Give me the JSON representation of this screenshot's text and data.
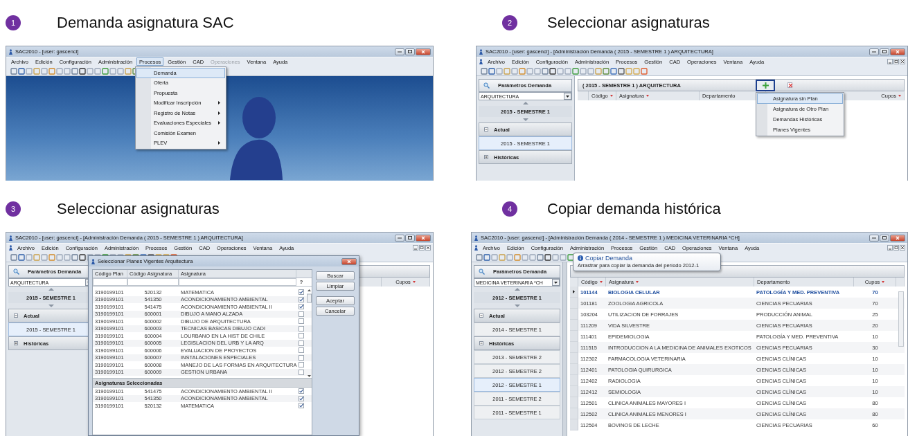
{
  "steps": [
    {
      "number": "1",
      "title": "Demanda asignatura SAC",
      "kind": "menu",
      "window": {
        "title": "SAC2010 - [user: gascenci]",
        "menus": [
          {
            "label": "Archivo",
            "selected": false,
            "disabled": false
          },
          {
            "label": "Edición",
            "selected": false,
            "disabled": false
          },
          {
            "label": "Configuración",
            "selected": false,
            "disabled": false
          },
          {
            "label": "Administración",
            "selected": false,
            "disabled": false
          },
          {
            "label": "Procesos",
            "selected": true,
            "disabled": false
          },
          {
            "label": "Gestión",
            "selected": false,
            "disabled": false
          },
          {
            "label": "CAD",
            "selected": false,
            "disabled": false
          },
          {
            "label": "Operaciones",
            "selected": false,
            "disabled": true
          },
          {
            "label": "Ventana",
            "selected": false,
            "disabled": false
          },
          {
            "label": "Ayuda",
            "selected": false,
            "disabled": false
          }
        ],
        "dropdown": [
          {
            "label": "Demanda",
            "selected": true,
            "submenu": false
          },
          {
            "label": "Oferta",
            "selected": false,
            "submenu": false
          },
          {
            "label": "Propuesta",
            "selected": false,
            "submenu": false
          },
          {
            "label": "Modificar Inscripción",
            "selected": false,
            "submenu": true
          },
          {
            "label": "Registro de Notas",
            "selected": false,
            "submenu": true
          },
          {
            "label": "Evaluaciones Especiales",
            "selected": false,
            "submenu": true
          },
          {
            "label": "Comisión Examen",
            "selected": false,
            "submenu": false
          },
          {
            "label": "PLEV",
            "selected": false,
            "submenu": true
          }
        ]
      }
    },
    {
      "number": "2",
      "title": "Seleccionar asignaturas",
      "kind": "add_menu",
      "window": {
        "title": "SAC2010 - [user: gascenci] - [Administración Demanda ( 2015 - SEMESTRE 1 ) ARQUITECTURA]",
        "menus": [
          {
            "label": "Archivo",
            "selected": false
          },
          {
            "label": "Edición",
            "selected": false
          },
          {
            "label": "Configuración",
            "selected": false
          },
          {
            "label": "Administración",
            "selected": false
          },
          {
            "label": "Procesos",
            "selected": false
          },
          {
            "label": "Gestión",
            "selected": false
          },
          {
            "label": "CAD",
            "selected": false
          },
          {
            "label": "Operaciones",
            "selected": false
          },
          {
            "label": "Ventana",
            "selected": false
          },
          {
            "label": "Ayuda",
            "selected": false
          }
        ],
        "sidebar": {
          "header": "Parámetros Demanda",
          "career": "ARQUITECTURA",
          "period": "2015 - SEMESTRE 1",
          "groups": [
            {
              "label": "Actual",
              "expanded": true,
              "children": [
                {
                  "label": "2015 - SEMESTRE 1",
                  "selected": true
                }
              ]
            },
            {
              "label": "Históricas",
              "expanded": false
            }
          ]
        },
        "main": {
          "header": "( 2015 - SEMESTRE 1 ) ARQUITECTURA",
          "columns": [
            {
              "label": "Código",
              "sortable": true
            },
            {
              "label": "Asignatura",
              "sortable": true
            },
            {
              "label": "Departamento",
              "sortable": false
            },
            {
              "label": "Cupos",
              "sortable": true
            }
          ],
          "popup": [
            {
              "label": "Asignatura sin Plan",
              "selected": true
            },
            {
              "label": "Asignatura de Otro Plan",
              "selected": false
            },
            {
              "label": "Demandas Históricas",
              "selected": false
            },
            {
              "label": "Planes Vigentes",
              "selected": false
            }
          ]
        }
      }
    },
    {
      "number": "3",
      "title": "Seleccionar asignaturas",
      "kind": "dialog",
      "window": {
        "title": "SAC2010 - [user: gascenci] - [Administración Demanda ( 2015 - SEMESTRE 1 ) ARQUITECTURA]",
        "menus": [
          {
            "label": "Archivo",
            "selected": false
          },
          {
            "label": "Edición",
            "selected": false
          },
          {
            "label": "Configuración",
            "selected": false
          },
          {
            "label": "Administración",
            "selected": false
          },
          {
            "label": "Procesos",
            "selected": false
          },
          {
            "label": "Gestión",
            "selected": false
          },
          {
            "label": "CAD",
            "selected": false
          },
          {
            "label": "Operaciones",
            "selected": false
          },
          {
            "label": "Ventana",
            "selected": false
          },
          {
            "label": "Ayuda",
            "selected": false
          }
        ],
        "sidebar": {
          "header": "Parámetros Demanda",
          "career": "ARQUITECTURA",
          "period": "2015 - SEMESTRE 1",
          "groups": [
            {
              "label": "Actual",
              "expanded": true,
              "children": [
                {
                  "label": "2015 - SEMESTRE 1",
                  "selected": true
                }
              ]
            },
            {
              "label": "Históricas",
              "expanded": false
            }
          ]
        },
        "main": {
          "columns": [
            {
              "label": "Cupos",
              "sortable": true
            }
          ]
        },
        "dialog": {
          "title": "Seleccionar Planes Vigentes Arquitectura",
          "columns": [
            "Código Plan",
            "Código Asignatura",
            "Asignatura"
          ],
          "filter_hint": "?",
          "rows": [
            {
              "plan": "3190199101",
              "code": "520132",
              "subject": "MATEMATICA",
              "checked": true
            },
            {
              "plan": "3190199101",
              "code": "541350",
              "subject": "ACONDICIONAMIENTO AMBIENTAL",
              "checked": true
            },
            {
              "plan": "3190199101",
              "code": "541475",
              "subject": "ACONDICIONAMIENTO AMBIENTAL II",
              "checked": true
            },
            {
              "plan": "3190199101",
              "code": "600001",
              "subject": "DIBUJO A MANO ALZADA",
              "checked": false
            },
            {
              "plan": "3190199101",
              "code": "600002",
              "subject": "DIBUJO DE ARQUITECTURA",
              "checked": false
            },
            {
              "plan": "3190199101",
              "code": "600003",
              "subject": "TECNICAS BASICAS DIBUJO CADI",
              "checked": false
            },
            {
              "plan": "3190199101",
              "code": "600004",
              "subject": "LOURBANO EN LA HIST DE CHILE",
              "checked": false
            },
            {
              "plan": "3190199101",
              "code": "600005",
              "subject": "LEGISLACION DEL URB Y LA ARQ",
              "checked": false
            },
            {
              "plan": "3190199101",
              "code": "600006",
              "subject": "EVALUACION DE PROYECTOS",
              "checked": false
            },
            {
              "plan": "3190199101",
              "code": "600007",
              "subject": "INSTALACIONES ESPECIALES",
              "checked": false
            },
            {
              "plan": "3190199101",
              "code": "600008",
              "subject": "MANEJO DE LAS FORMAS EN ARQUITECTURA",
              "checked": false
            },
            {
              "plan": "3190199101",
              "code": "600009",
              "subject": "GESTION URBANA",
              "checked": false
            }
          ],
          "section": "Asignaturas Seleccionadas",
          "selected_rows": [
            {
              "plan": "3190199101",
              "code": "541475",
              "subject": "ACONDICIONAMIENTO AMBIENTAL II",
              "checked": true
            },
            {
              "plan": "3190199101",
              "code": "541350",
              "subject": "ACONDICIONAMIENTO AMBIENTAL",
              "checked": true
            },
            {
              "plan": "3190199101",
              "code": "520132",
              "subject": "MATEMATICA",
              "checked": true
            }
          ],
          "buttons": [
            "Buscar",
            "Limpiar",
            "Aceptar",
            "Cancelar"
          ]
        }
      }
    },
    {
      "number": "4",
      "title": "Copiar demanda histórica",
      "kind": "grid",
      "window": {
        "title": "SAC2010 - [user: gascenci] - [Administración Demanda ( 2014 - SEMESTRE 1 ) MEDICINA VETERINARIA *CH]",
        "menus": [
          {
            "label": "Archivo",
            "selected": false
          },
          {
            "label": "Edición",
            "selected": false
          },
          {
            "label": "Configuración",
            "selected": false
          },
          {
            "label": "Administración",
            "selected": false
          },
          {
            "label": "Procesos",
            "selected": false
          },
          {
            "label": "Gestión",
            "selected": false
          },
          {
            "label": "CAD",
            "selected": false
          },
          {
            "label": "Operaciones",
            "selected": false
          },
          {
            "label": "Ventana",
            "selected": false
          },
          {
            "label": "Ayuda",
            "selected": false
          }
        ],
        "sidebar": {
          "header": "Parámetros Demanda",
          "career": "MEDICINA VETERINARIA *CH",
          "period": "2012 - SEMESTRE 1",
          "groups": [
            {
              "label": "Actual",
              "expanded": true,
              "children": [
                {
                  "label": "2014 - SEMESTRE 1",
                  "selected": false
                }
              ]
            },
            {
              "label": "Históricas",
              "expanded": true,
              "children": [
                {
                  "label": "2013 - SEMESTRE 2",
                  "selected": false
                },
                {
                  "label": "2012 - SEMESTRE 2",
                  "selected": false
                },
                {
                  "label": "2012 - SEMESTRE 1",
                  "selected": true
                },
                {
                  "label": "2011 - SEMESTRE 2",
                  "selected": false
                },
                {
                  "label": "2011 - SEMESTRE 1",
                  "selected": false
                }
              ]
            }
          ]
        },
        "tooltip": {
          "title": "Copiar Demanda",
          "text": "Arrastrar para copiar  la demanda del período  2012-1"
        },
        "main": {
          "columns": [
            {
              "label": "Código",
              "sortable": true
            },
            {
              "label": "Asignatura",
              "sortable": true
            },
            {
              "label": "Departamento",
              "sortable": false
            },
            {
              "label": "Cupos",
              "sortable": true
            }
          ],
          "rows": [
            {
              "code": "101144",
              "subject": "BIOLOGIA CELULAR",
              "department": "PATOLOGÍA Y MED. PREVENTIVA",
              "quota": "70",
              "selected": true
            },
            {
              "code": "101181",
              "subject": "ZOOLOGIA AGRICOLA",
              "department": "CIENCIAS PECUARIAS",
              "quota": "70",
              "selected": false
            },
            {
              "code": "103204",
              "subject": "UTILIZACION DE FORRAJES",
              "department": "PRODUCCIÓN ANIMAL",
              "quota": "25",
              "selected": false
            },
            {
              "code": "111209",
              "subject": "VIDA SILVESTRE",
              "department": "CIENCIAS PECUARIAS",
              "quota": "20",
              "selected": false
            },
            {
              "code": "111401",
              "subject": "EPIDEMIOLOGIA",
              "department": "PATOLOGÍA Y MED. PREVENTIVA",
              "quota": "10",
              "selected": false
            },
            {
              "code": "111515",
              "subject": "INTRODUCCION A LA MEDICINA DE ANIMALES EXOTICOS",
              "department": "CIENCIAS PECUARIAS",
              "quota": "30",
              "selected": false
            },
            {
              "code": "112302",
              "subject": "FARMACOLOGIA VETERINARIA",
              "department": "CIENCIAS CLÍNICAS",
              "quota": "10",
              "selected": false
            },
            {
              "code": "112401",
              "subject": "PATOLOGIA QUIRURGICA",
              "department": "CIENCIAS CLÍNICAS",
              "quota": "10",
              "selected": false
            },
            {
              "code": "112402",
              "subject": "RADIOLOGIA",
              "department": "CIENCIAS CLÍNICAS",
              "quota": "10",
              "selected": false
            },
            {
              "code": "112412",
              "subject": "SEMIOLOGIA",
              "department": "CIENCIAS CLÍNICAS",
              "quota": "10",
              "selected": false
            },
            {
              "code": "112501",
              "subject": "CLINICA ANIMALES MAYORES I",
              "department": "CIENCIAS CLÍNICAS",
              "quota": "80",
              "selected": false
            },
            {
              "code": "112502",
              "subject": "CLINICA ANIMALES MENORES I",
              "department": "CIENCIAS CLÍNICAS",
              "quota": "80",
              "selected": false
            },
            {
              "code": "112504",
              "subject": "BOVINOS DE LECHE",
              "department": "CIENCIAS PECUARIAS",
              "quota": "60",
              "selected": false
            }
          ]
        }
      }
    }
  ]
}
